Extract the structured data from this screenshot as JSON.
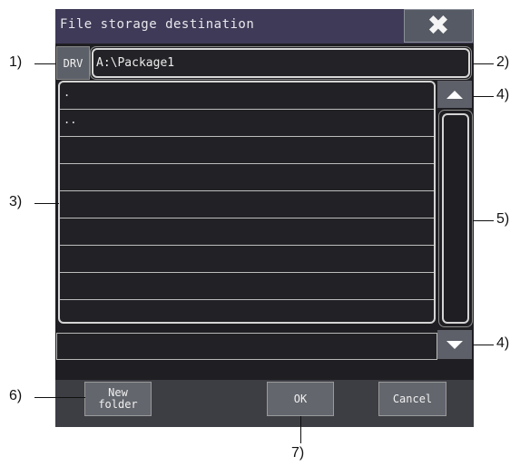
{
  "dialog": {
    "title": "File storage destination",
    "close_icon": "close-x-icon"
  },
  "drive": {
    "label": "DRV"
  },
  "path": {
    "value": "A:\\Package1"
  },
  "file_list": {
    "rows": [
      ".",
      "..",
      "",
      "",
      "",
      "",
      "",
      "",
      ""
    ]
  },
  "scrollbar": {
    "up_icon": "triangle-up-icon",
    "down_icon": "triangle-down-icon"
  },
  "buttons": {
    "new_folder": "New\nfolder",
    "ok": "OK",
    "cancel": "Cancel"
  },
  "callouts": {
    "c1": "1)",
    "c2": "2)",
    "c3": "3)",
    "c4a": "4)",
    "c4b": "4)",
    "c5": "5)",
    "c6": "6)",
    "c7": "7)"
  }
}
